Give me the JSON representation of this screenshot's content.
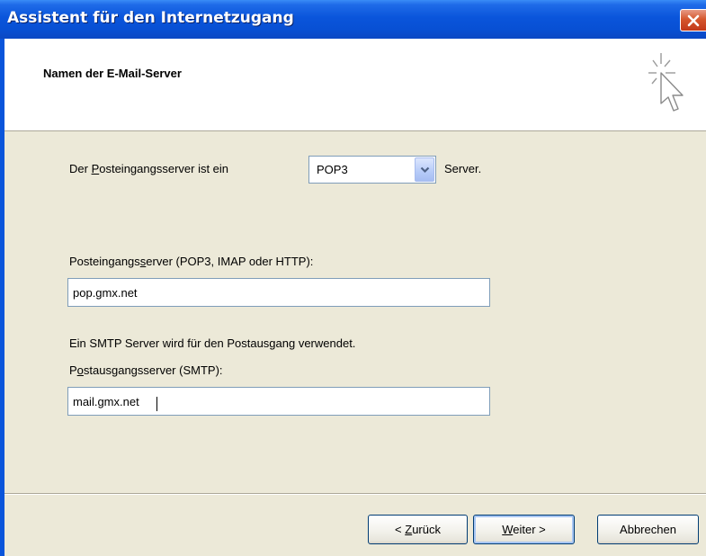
{
  "window": {
    "title": "Assistent für den Internetzugang",
    "close_icon": "close-icon"
  },
  "header": {
    "title": "Namen der E-Mail-Server",
    "icon": "wizard-cursor-icon"
  },
  "incoming_type": {
    "label_before": "Der ",
    "label_accel": "P",
    "label_after": "osteingangsserver ist ein",
    "selected": "POP3",
    "suffix": "Server."
  },
  "incoming_server": {
    "label_before": "Posteingangs",
    "label_accel": "s",
    "label_after": "erver (POP3, IMAP oder HTTP):",
    "value": "pop.gmx.net"
  },
  "smtp_note": "Ein SMTP Server wird für den Postausgang verwendet.",
  "outgoing_server": {
    "label_before": "P",
    "label_accel": "o",
    "label_after": "stausgangsserver (SMTP):",
    "value": "mail.gmx.net"
  },
  "buttons": {
    "back_prefix": "< ",
    "back_accel": "Z",
    "back_rest": "urück",
    "next_accel": "W",
    "next_rest": "eiter >",
    "cancel": "Abbrechen"
  },
  "colors": {
    "titlebar": "#0A55DB",
    "dialog_bg": "#ECE9D8",
    "close": "#D5572E"
  }
}
